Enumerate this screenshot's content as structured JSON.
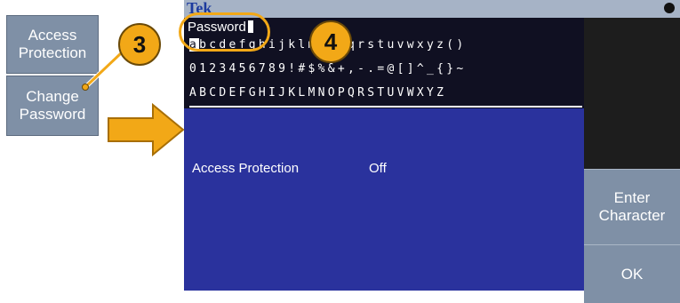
{
  "left_menu": {
    "access_protection": [
      "Access",
      "Protection"
    ],
    "change_password": [
      "Change",
      "Password"
    ]
  },
  "callouts": {
    "step3": "3",
    "step4": "4"
  },
  "screen": {
    "brand": "Tek",
    "password_label": "Password",
    "keyboard_rows": [
      [
        "a",
        "bcdefghijklmnopqrstuvwxyz()"
      ],
      [
        "",
        "0123456789!#$%&+,-.=@[]^_{}~"
      ],
      [
        "",
        "ABCDEFGHIJKLMNOPQRSTUVWXYZ"
      ]
    ],
    "setting_label": "Access Protection",
    "setting_value": "Off"
  },
  "softkeys": {
    "enter_character": [
      "Enter",
      "Character"
    ],
    "ok": "OK"
  },
  "colors": {
    "callout": "#f2a817",
    "screen_bg": "#2a329d",
    "softkey": "#7f90a6"
  },
  "icons": [
    "arrow-right-icon",
    "status-indicator-icon"
  ]
}
